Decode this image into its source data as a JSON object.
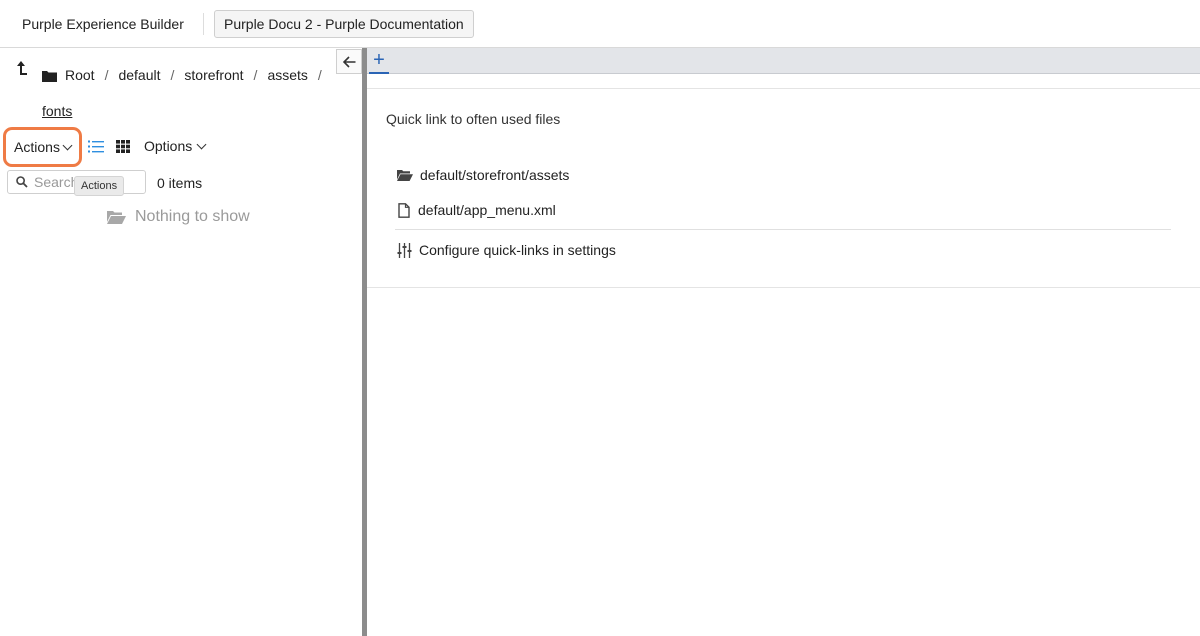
{
  "header": {
    "app_title": "Purple Experience Builder",
    "project_label": "Purple Docu 2 - Purple Documentation"
  },
  "file_browser": {
    "breadcrumb": [
      "Root",
      "default",
      "storefront",
      "assets"
    ],
    "breadcrumb_separator": "/",
    "current_folder": "fonts",
    "actions_label": "Actions",
    "options_label": "Options",
    "search_placeholder": "Search",
    "items_count": "0 items",
    "tooltip": "Actions",
    "empty_text": "Nothing to show"
  },
  "editor": {
    "add_tab_label": "+",
    "quick_links_title": "Quick link to often used files",
    "quick_links": [
      {
        "label": "default/storefront/assets",
        "icon": "folder-open-icon"
      },
      {
        "label": "default/app_menu.xml",
        "icon": "file-icon"
      }
    ],
    "configure_label": "Configure quick-links in settings"
  },
  "colors": {
    "highlight": "#ef7b45",
    "accent_blue": "#2a64b5",
    "list_view_active": "#2f8fe0"
  }
}
